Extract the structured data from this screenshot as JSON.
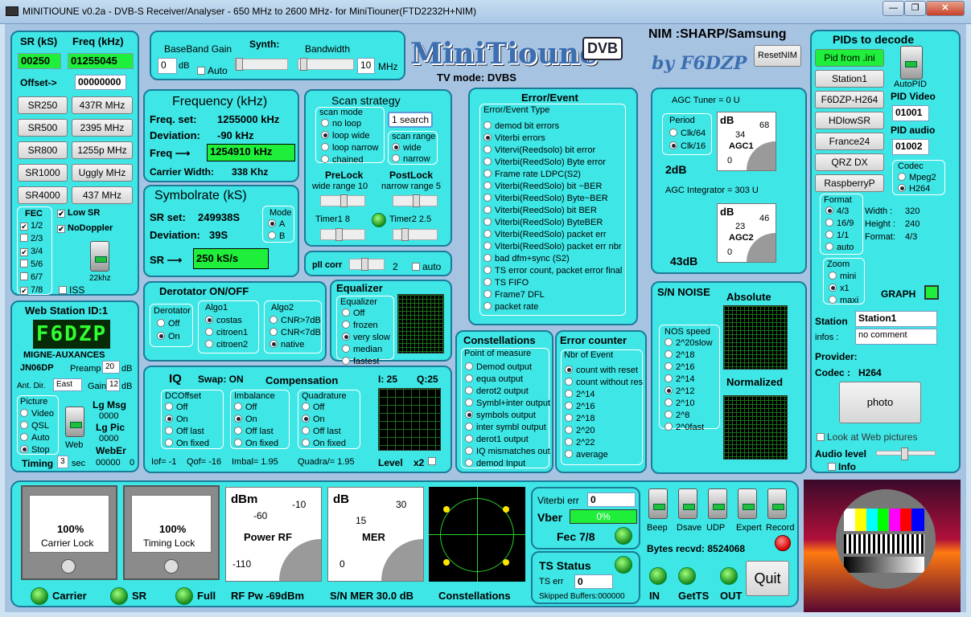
{
  "window": {
    "title": "MINITIOUNE v0.2a - DVB-S Receiver/Analyser - 650 MHz to 2600 MHz- for MiniTiouner(FTD2232H+NIM)",
    "controls": [
      "—",
      "❐",
      "✕"
    ]
  },
  "logo": {
    "main": "MiniTioune",
    "badge": "DVB",
    "by": "by F6DZP"
  },
  "nim": {
    "label": "NIM :SHARP/Samsung",
    "reset": "ResetNIM",
    "tvmode": "TV mode:  DVBS"
  },
  "left": {
    "sr_label": "SR (kS)",
    "freq_label": "Freq (kHz)",
    "sr": "00250",
    "freq": "01255045",
    "offset_label": "Offset->",
    "offset": "00000000",
    "sr_buttons": [
      "SR250",
      "SR500",
      "SR800",
      "SR1000",
      "SR4000"
    ],
    "freq_buttons": [
      "437R MHz",
      "2395 MHz",
      "1255p MHz",
      "Uggly MHz",
      "437 MHz"
    ],
    "fec_title": "FEC",
    "fec": [
      {
        "l": "1/2",
        "c": true
      },
      {
        "l": "2/3",
        "c": false
      },
      {
        "l": "3/4",
        "c": true
      },
      {
        "l": "5/6",
        "c": false
      },
      {
        "l": "6/7",
        "c": false
      },
      {
        "l": "7/8",
        "c": true
      }
    ],
    "lowsr": "Low SR",
    "nodoppler": "NoDoppler",
    "khz": "22khz",
    "iss": "ISS"
  },
  "web": {
    "title": "Web Station ID:1",
    "callsign": "F6DZP",
    "qth": "MIGNE-AUXANCES",
    "loc": "JN06DP",
    "preamp_l": "Preamp",
    "preamp": "20",
    "db": "dB",
    "antdir_l": "Ant. Dir.",
    "antdir": "East",
    "gain_l": "Gain",
    "gain": "12",
    "picture": "Picture",
    "pics": [
      "Video",
      "QSL",
      "Auto",
      "Stop"
    ],
    "web": "Web",
    "lgmsg": "Lg Msg",
    "lgmsg_v": "0000",
    "lgpic": "Lg Pic",
    "lgpic_v": "0000",
    "weber": "WebEr",
    "weber_v": "00000",
    "zero": "0",
    "timing": "Timing",
    "timing_v": "3",
    "sec": "sec"
  },
  "baseband": {
    "gain_l": "BaseBand Gain",
    "synth": "Synth:",
    "bw": "Bandwidth",
    "gain": "0",
    "db": "dB",
    "auto": "Auto",
    "bwval": "10",
    "mhz": "MHz"
  },
  "freq": {
    "title": "Frequency (kHz)",
    "set_l": "Freq. set:",
    "set": "1255000 kHz",
    "dev_l": "Deviation:",
    "dev": "-90 kHz",
    "freq_l": "Freq ⟶",
    "freq": "1254910 kHz",
    "cw_l": "Carrier Width:",
    "cw": "338 Khz"
  },
  "sym": {
    "title": "Symbolrate (kS)",
    "set_l": "SR set:",
    "set": "249938S",
    "dev_l": "Deviation:",
    "dev": "39S",
    "sr_l": "SR ⟶",
    "sr": "250 kS/s",
    "mode": "Mode",
    "modes": [
      "A",
      "B"
    ]
  },
  "scan": {
    "title": "Scan strategy",
    "mode": "scan mode",
    "modes": [
      "no loop",
      "loop wide",
      "loop narrow",
      "chained"
    ],
    "search": "1 search",
    "range": "scan range",
    "ranges": [
      "wide",
      "narrow"
    ],
    "prelock": "PreLock",
    "postlock": "PostLock",
    "wide": "wide range  10",
    "narrow": "narrow range  5",
    "t1": "Timer1    8",
    "t2": "Timer2   2.5"
  },
  "pll": {
    "label": "pll corr",
    "val": "2",
    "auto": "auto"
  },
  "err": {
    "title": "Error/Event",
    "type": "Error/Event Type",
    "items": [
      "demod bit errors",
      "Viterbi errors",
      "Vitervi(Reedsolo) bit error",
      "Viterbi(ReedSolo) Byte error",
      "Frame rate LDPC(S2)",
      "Viterbi(ReedSolo) bit ~BER",
      "Viterbi(ReedSolo) Byte~BER",
      "Viterbi(ReedSolo) bit BER",
      "Viterbi(ReedSolo) ByteBER",
      "Viterbi(ReedSolo) packet err",
      "Viterbi(ReedSolo) packet err nbr",
      "bad dfm+sync (S2)",
      "TS error count, packet error final",
      "TS FIFO",
      "Frame7 DFL",
      "packet rate"
    ]
  },
  "agc": {
    "tuner": "AGC Tuner =   0 U",
    "period": "Period",
    "p1": "Clk/64",
    "p2": "Clk/16",
    "agc1_db": "2dB",
    "integ": "AGC Integrator =   303 U",
    "agc2_db": "43dB",
    "agc1": "AGC1",
    "agc2": "AGC2",
    "m1a": "34",
    "m1b": "68",
    "m2a": "23",
    "m2b": "46",
    "db": "dB",
    "zero": "0"
  },
  "derot": {
    "title": "Derotator  ON/OFF",
    "d": "Derotator",
    "off": "Off",
    "on": "On",
    "algo1": "Algo1",
    "a1": [
      "costas",
      "citroen1",
      "citroen2"
    ],
    "algo2": "Algo2",
    "a2": [
      "CNR>7dB",
      "CNR<7dB",
      "native"
    ]
  },
  "eq": {
    "title": "Equalizer",
    "sub": "Equalizer",
    "items": [
      "Off",
      "frozen",
      "very slow",
      "median",
      "fastest"
    ]
  },
  "iq": {
    "title": "IQ",
    "swap": "Swap:  ON",
    "comp": "Compensation",
    "i": "I: 25",
    "q": "Q:25",
    "dc": "DCOffset",
    "imb": "Imbalance",
    "quad": "Quadrature",
    "opts": [
      "Off",
      "On",
      "Off last",
      "On fixed"
    ],
    "iof": "Iof= -1",
    "qof": "Qof= -16",
    "imbal": "Imbal=  1.95",
    "quadra": "Quadra/=  1.95",
    "level": "Level",
    "x2": "x2"
  },
  "const": {
    "title": "Constellations",
    "pom": "Point of measure",
    "items": [
      "Demod output",
      "equa output",
      "derot2 output",
      "Symbl+inter output",
      "symbols output",
      "inter symbl output",
      "derot1 output",
      "IQ mismatches out",
      "demod Input"
    ]
  },
  "errc": {
    "title": "Error counter",
    "nbr": "Nbr of Event",
    "items": [
      "count with reset",
      "count without res",
      "2^14",
      "2^16",
      "2^18",
      "2^20",
      "2^22",
      "average"
    ]
  },
  "sn": {
    "title": "S/N NOISE",
    "abs": "Absolute",
    "norm": "Normalized",
    "nos": "NOS speed",
    "items": [
      "2^20slow",
      "2^18",
      "2^16",
      "2^14",
      "2^12",
      "2^10",
      "2^8",
      "2^0fast"
    ]
  },
  "pids": {
    "title": "PIDs to decode",
    "ini": "Pid from .ini",
    "buttons": [
      "Station1",
      "F6DZP-H264",
      "HDlowSR",
      "France24",
      "QRZ DX",
      "RaspberryP"
    ],
    "autopid": "AutoPID",
    "pidv_l": "PID Video",
    "pidv": "01001",
    "pida_l": "PID audio",
    "pida": "01002",
    "codec": "Codec",
    "codecs": [
      "Mpeg2",
      "H264"
    ],
    "format": "Format",
    "formats": [
      "4/3",
      "16/9",
      "1/1",
      "auto"
    ],
    "width": "Width :",
    "width_v": "320",
    "height": "Height :",
    "height_v": "240",
    "fmt": "Format:",
    "fmt_v": "4/3",
    "zoom": "Zoom",
    "zooms": [
      "mini",
      "x1",
      "maxi"
    ],
    "graph": "GRAPH",
    "station_l": "Station",
    "station": "Station1",
    "infos_l": "infos :",
    "infos": "no comment",
    "provider": "Provider:",
    "codec_l": "Codec :",
    "codec_v": "H264",
    "photo": "photo",
    "lookweb": "Look at Web pictures",
    "audio": "Audio level",
    "info": "Info"
  },
  "bottom": {
    "carrier_pct": "100%",
    "carrier_lock": "Carrier Lock",
    "timing_pct": "100%",
    "timing_lock": "Timing Lock",
    "dbm": "dBm",
    "rf_vals": [
      "-60",
      "-10",
      "-110"
    ],
    "powerrf": "Power RF",
    "db": "dB",
    "mer_vals": [
      "15",
      "30",
      "0"
    ],
    "mer": "MER",
    "vit_l": "Viterbi err",
    "vit": "0",
    "vber": "Vber",
    "vber_v": "0%",
    "fec": "Fec 7/8",
    "ts": "TS Status",
    "tserr_l": "TS err",
    "tserr": "0",
    "skipped": "Skipped Buffers:000000",
    "switches": [
      "Beep",
      "Dsave",
      "UDP",
      "Expert",
      "Record"
    ],
    "bytes": "Bytes recvd:   8524068",
    "quit": "Quit",
    "leds": [
      "IN",
      "GetTS",
      "OUT"
    ],
    "status": [
      "Carrier",
      "SR",
      "Full"
    ],
    "rfpw": "RF Pw  -69dBm",
    "snmer": "S/N MER  30.0 dB",
    "consts": "Constellations"
  }
}
